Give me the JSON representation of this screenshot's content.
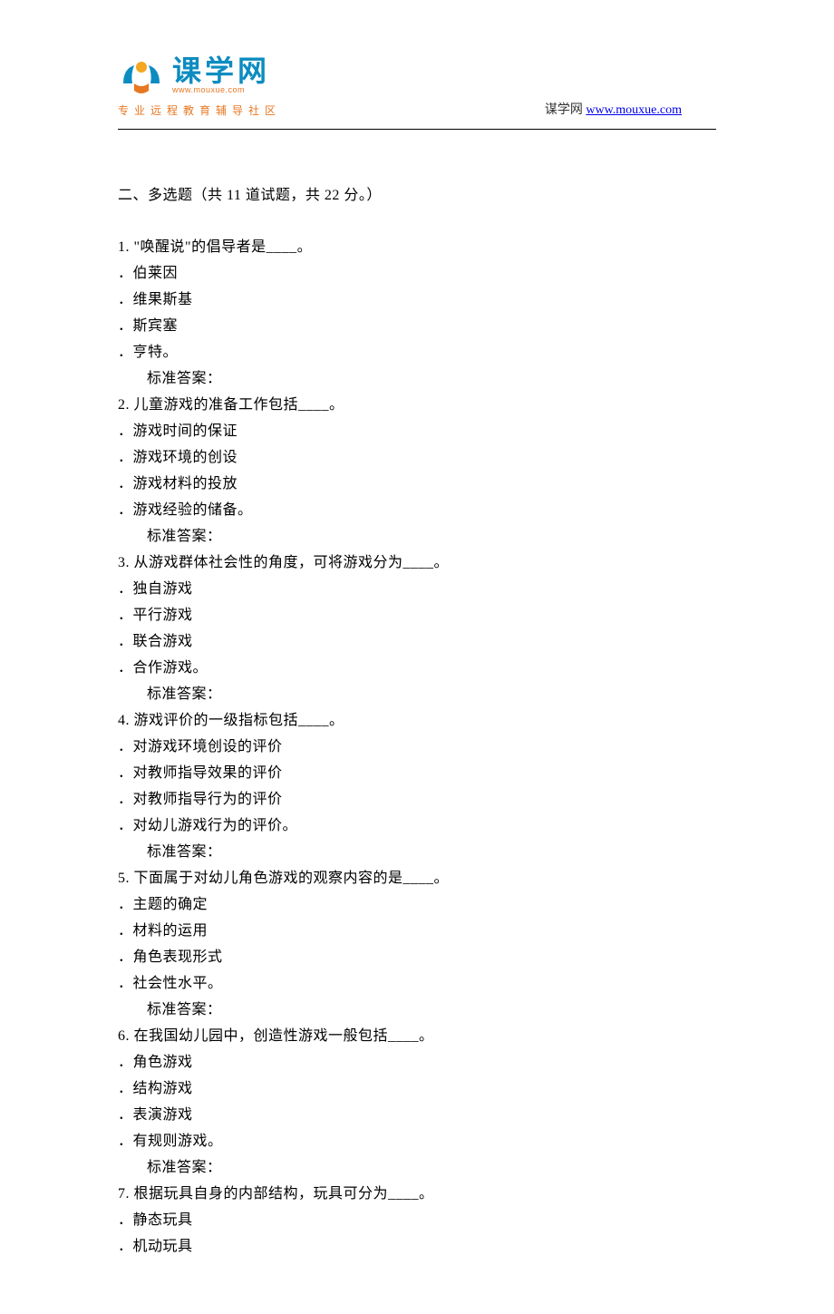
{
  "logo": {
    "cn": "课学网",
    "url": "www.mouxue.com",
    "sub": "专业远程教育辅导社区"
  },
  "header_right": {
    "prefix": "谋学网 ",
    "link_text": "www.mouxue.com"
  },
  "section_title": "二、多选题（共 11 道试题，共 22 分。）",
  "answer_label": "标准答案：",
  "questions": [
    {
      "num": "1.",
      "stem": "  \"唤醒说\"的倡导者是____。",
      "options": [
        "．伯莱因",
        "．维果斯基",
        "．斯宾塞",
        "．亨特。"
      ]
    },
    {
      "num": "2.",
      "stem": "  儿童游戏的准备工作包括____。",
      "options": [
        "．游戏时间的保证",
        "．游戏环境的创设",
        "．游戏材料的投放",
        "．游戏经验的储备。"
      ]
    },
    {
      "num": "3.",
      "stem": "  从游戏群体社会性的角度，可将游戏分为____。",
      "options": [
        "．独自游戏",
        "．平行游戏",
        "．联合游戏",
        "．合作游戏。"
      ]
    },
    {
      "num": "4.",
      "stem": "  游戏评价的一级指标包括____。",
      "options": [
        "．对游戏环境创设的评价",
        "．对教师指导效果的评价",
        "．对教师指导行为的评价",
        "．对幼儿游戏行为的评价。"
      ]
    },
    {
      "num": "5.",
      "stem": "  下面属于对幼儿角色游戏的观察内容的是____。",
      "options": [
        "．主题的确定",
        "．材料的运用",
        "．角色表现形式",
        "．社会性水平。"
      ]
    },
    {
      "num": "6.",
      "stem": "  在我国幼儿园中，创造性游戏一般包括____。",
      "options": [
        "．角色游戏",
        "．结构游戏",
        "．表演游戏",
        "．有规则游戏。"
      ]
    },
    {
      "num": "7.",
      "stem": "  根据玩具自身的内部结构，玩具可分为____。",
      "options": [
        "．静态玩具",
        "．机动玩具"
      ]
    }
  ]
}
